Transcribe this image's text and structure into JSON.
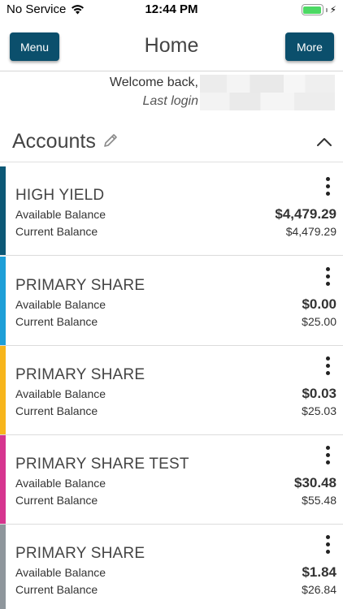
{
  "status_bar": {
    "carrier": "No Service",
    "time": "12:44 PM",
    "wifi_icon": "wifi-icon",
    "battery_icon": "battery-charging-icon"
  },
  "nav": {
    "menu_label": "Menu",
    "title": "Home",
    "more_label": "More",
    "button_color": "#0b4f6c"
  },
  "welcome": {
    "greeting": "Welcome back,",
    "last_login_label": "Last login"
  },
  "accounts": {
    "title": "Accounts",
    "edit_icon": "pencil-icon",
    "collapse_icon": "chevron-up-icon",
    "items": [
      {
        "name": "HIGH YIELD",
        "available_label": "Available Balance",
        "available": "$4,479.29",
        "current_label": "Current Balance",
        "current": "$4,479.29",
        "color": "#0c5876"
      },
      {
        "name": "PRIMARY SHARE",
        "available_label": "Available Balance",
        "available": "$0.00",
        "current_label": "Current Balance",
        "current": "$25.00",
        "color": "#1e9fd8"
      },
      {
        "name": "PRIMARY SHARE",
        "available_label": "Available Balance",
        "available": "$0.03",
        "current_label": "Current Balance",
        "current": "$25.03",
        "color": "#f7b51b"
      },
      {
        "name": "PRIMARY SHARE TEST",
        "available_label": "Available Balance",
        "available": "$30.48",
        "current_label": "Current Balance",
        "current": "$55.48",
        "color": "#d6358f"
      },
      {
        "name": "PRIMARY SHARE",
        "available_label": "Available Balance",
        "available": "$1.84",
        "current_label": "Current Balance",
        "current": "$26.84",
        "color": "#8e969c"
      }
    ]
  }
}
